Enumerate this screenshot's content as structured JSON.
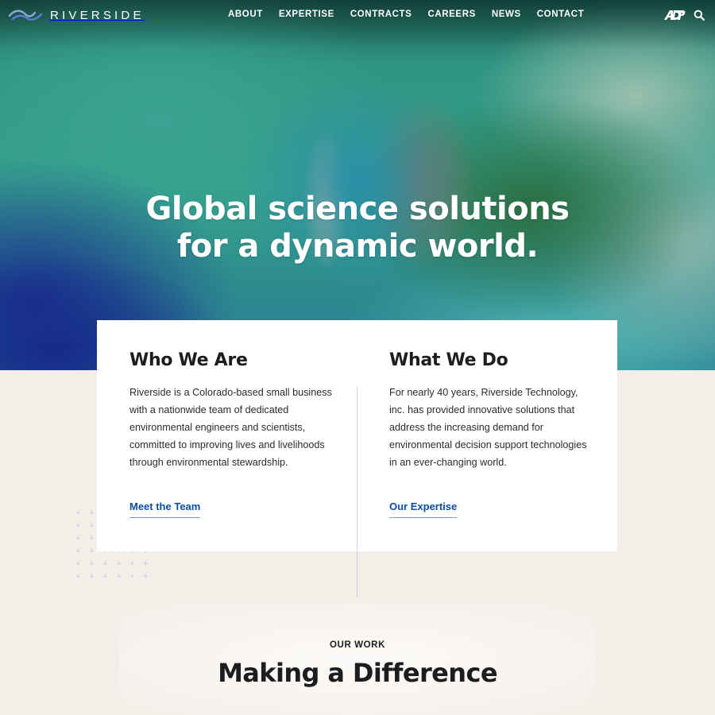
{
  "brand": {
    "name": "RIVERSIDE",
    "logo_icon": "wave-logo-icon",
    "colors": {
      "link": "#0d4d9f",
      "link_underline": "#7aa1dc",
      "page_bg": "#f4eee8",
      "card_bg": "#ffffff"
    }
  },
  "nav": {
    "items": [
      {
        "label": "ABOUT"
      },
      {
        "label": "EXPERTISE"
      },
      {
        "label": "CONTRACTS"
      },
      {
        "label": "CAREERS"
      },
      {
        "label": "NEWS"
      },
      {
        "label": "CONTACT"
      }
    ],
    "adp_icon": "adp-logo-icon",
    "search_icon": "search-icon"
  },
  "hero": {
    "headline_line1": "Global science solutions",
    "headline_line2": "for a dynamic world."
  },
  "intro": {
    "who": {
      "title": "Who We Are",
      "body": "Riverside is a Colorado-based small business with a nationwide team of dedicated environmental engineers and scientists, committed to improving lives and livelihoods through environmental stewardship.",
      "link": "Meet the Team"
    },
    "what": {
      "title": "What We Do",
      "body": "For nearly 40 years, Riverside Technology, inc. has provided innovative solutions that address the increasing demand for environmental decision support technologies in an ever-changing world.",
      "link": "Our Expertise"
    }
  },
  "our_work": {
    "label": "OUR WORK",
    "title": "Making a Difference"
  }
}
